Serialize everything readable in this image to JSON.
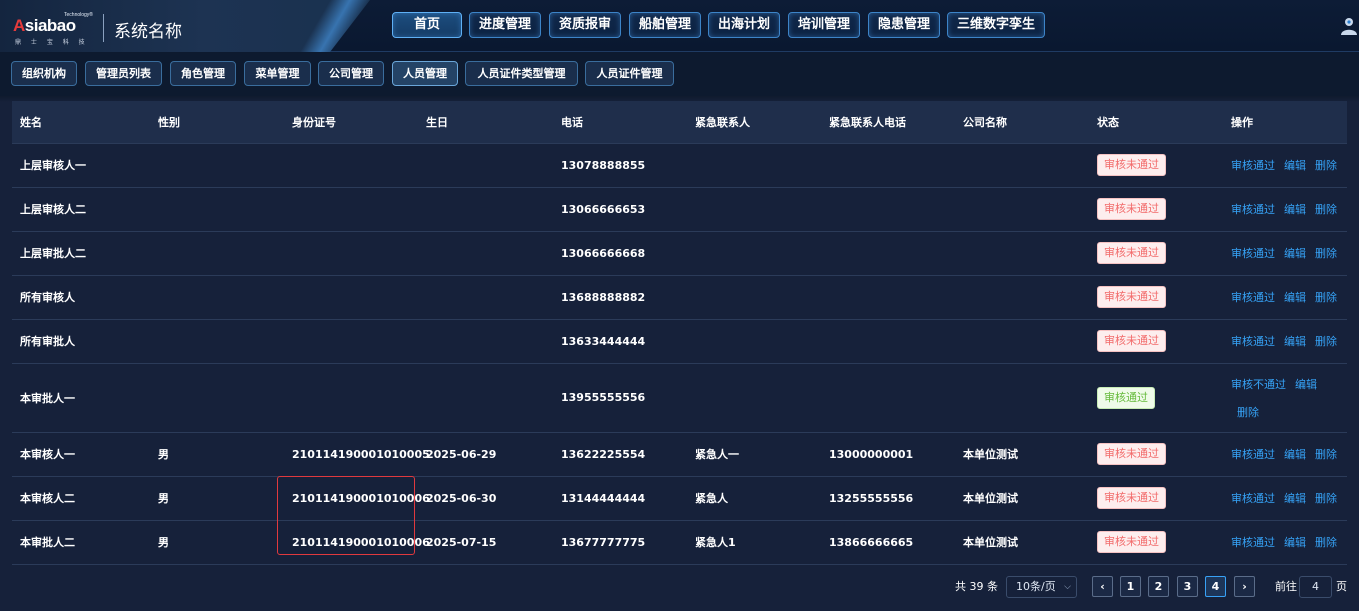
{
  "header": {
    "logo": {
      "tech": "Technology®",
      "word_a": "A",
      "word_rest": "siabao",
      "sub": "鼎 士 宝 科 技"
    },
    "system_name": "系统名称",
    "nav": [
      "首页",
      "进度管理",
      "资质报审",
      "船舶管理",
      "出海计划",
      "培训管理",
      "隐患管理",
      "三维数字孪生"
    ],
    "active_nav": "首页",
    "help_icon": "person-help-icon"
  },
  "tabs": [
    "组织机构",
    "管理员列表",
    "角色管理",
    "菜单管理",
    "公司管理",
    "人员管理",
    "人员证件类型管理",
    "人员证件管理"
  ],
  "active_tab": "人员管理",
  "table": {
    "columns": [
      "姓名",
      "性别",
      "身份证号",
      "生日",
      "电话",
      "紧急联系人",
      "紧急联系人电话",
      "公司名称",
      "状态",
      "操作"
    ],
    "rows": [
      {
        "name": "上层审核人一",
        "gender": "",
        "id_no": "",
        "birthday": "",
        "phone": "13078888855",
        "emergency_contact": "",
        "emergency_phone": "",
        "company": "",
        "status": "审核未通过",
        "status_type": "fail",
        "actions": [
          "审核通过",
          "编辑",
          "删除"
        ]
      },
      {
        "name": "上层审核人二",
        "gender": "",
        "id_no": "",
        "birthday": "",
        "phone": "13066666653",
        "emergency_contact": "",
        "emergency_phone": "",
        "company": "",
        "status": "审核未通过",
        "status_type": "fail",
        "actions": [
          "审核通过",
          "编辑",
          "删除"
        ]
      },
      {
        "name": "上层审批人二",
        "gender": "",
        "id_no": "",
        "birthday": "",
        "phone": "13066666668",
        "emergency_contact": "",
        "emergency_phone": "",
        "company": "",
        "status": "审核未通过",
        "status_type": "fail",
        "actions": [
          "审核通过",
          "编辑",
          "删除"
        ]
      },
      {
        "name": "所有审核人",
        "gender": "",
        "id_no": "",
        "birthday": "",
        "phone": "13688888882",
        "emergency_contact": "",
        "emergency_phone": "",
        "company": "",
        "status": "审核未通过",
        "status_type": "fail",
        "actions": [
          "审核通过",
          "编辑",
          "删除"
        ]
      },
      {
        "name": "所有审批人",
        "gender": "",
        "id_no": "",
        "birthday": "",
        "phone": "13633444444",
        "emergency_contact": "",
        "emergency_phone": "",
        "company": "",
        "status": "审核未通过",
        "status_type": "fail",
        "actions": [
          "审核通过",
          "编辑",
          "删除"
        ]
      },
      {
        "name": "本审批人一",
        "gender": "",
        "id_no": "",
        "birthday": "",
        "phone": "13955555556",
        "emergency_contact": "",
        "emergency_phone": "",
        "company": "",
        "status": "审核通过",
        "status_type": "pass",
        "actions": [
          "审核不通过",
          "编辑",
          "删除"
        ]
      },
      {
        "name": "本审核人一",
        "gender": "男",
        "id_no": "210114190001010005",
        "birthday": "2025-06-29",
        "phone": "13622225554",
        "emergency_contact": "紧急人一",
        "emergency_phone": "13000000001",
        "company": "本单位测试",
        "status": "审核未通过",
        "status_type": "fail",
        "actions": [
          "审核通过",
          "编辑",
          "删除"
        ]
      },
      {
        "name": "本审核人二",
        "gender": "男",
        "id_no": "210114190001010006",
        "birthday": "2025-06-30",
        "phone": "13144444444",
        "emergency_contact": "紧急人",
        "emergency_phone": "13255555556",
        "company": "本单位测试",
        "status": "审核未通过",
        "status_type": "fail",
        "actions": [
          "审核通过",
          "编辑",
          "删除"
        ]
      },
      {
        "name": "本审批人二",
        "gender": "男",
        "id_no": "210114190001010006",
        "birthday": "2025-07-15",
        "phone": "13677777775",
        "emergency_contact": "紧急人1",
        "emergency_phone": "13866666665",
        "company": "本单位测试",
        "status": "审核未通过",
        "status_type": "fail",
        "actions": [
          "审核通过",
          "编辑",
          "删除"
        ]
      }
    ]
  },
  "pagination": {
    "total_text": "共 39 条",
    "page_size": "10条/页",
    "pages": [
      "1",
      "2",
      "3",
      "4"
    ],
    "current_page": "4",
    "prev_icon": "chevron-left-icon",
    "next_icon": "chevron-right-icon",
    "goto_label": "前往",
    "goto_value": "4",
    "goto_suffix": "页"
  },
  "colors": {
    "accent": "#36a3f7",
    "fail_text": "#f26b6b",
    "pass_text": "#66bb3c",
    "highlight_border": "#e0393e",
    "background": "#16213a"
  }
}
